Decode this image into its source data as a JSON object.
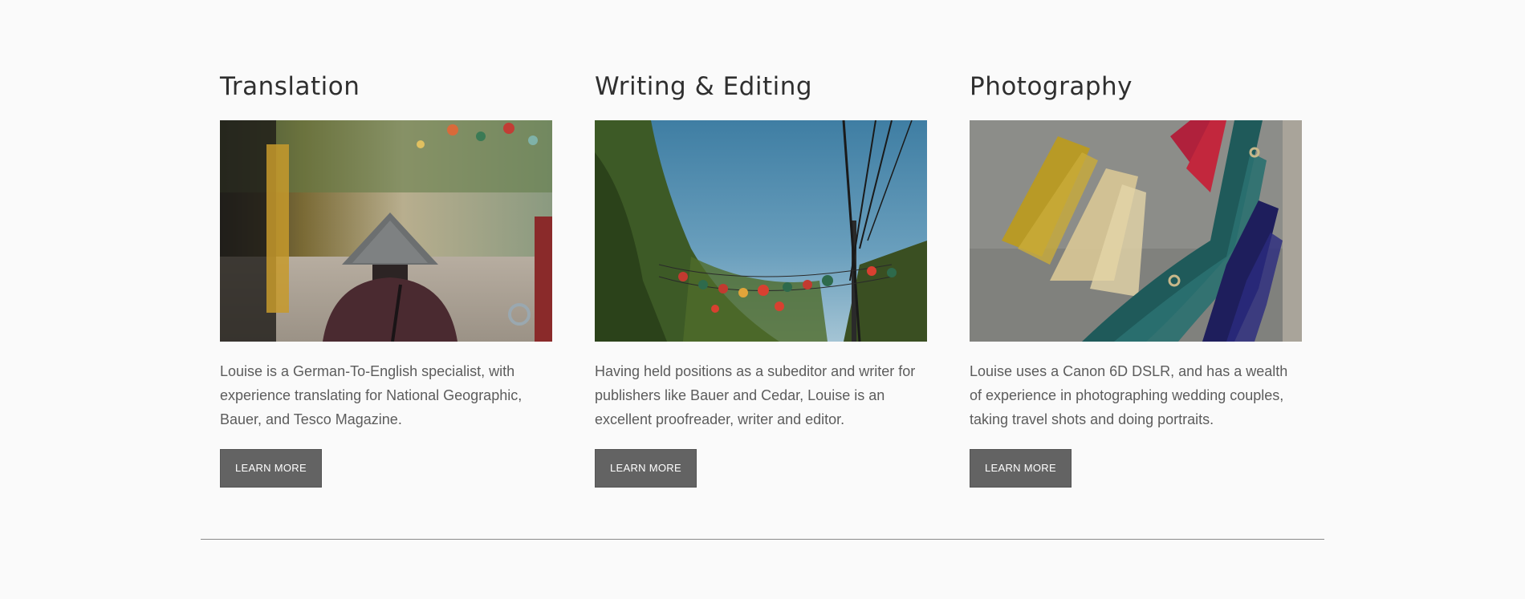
{
  "services": [
    {
      "title": "Translation",
      "image_desc_icon": "street-with-conical-hat-photo",
      "text": "Louise is a German-To-English specialist, with experience translating for National Geographic, Bauer, and Tesco Magazine.",
      "button_label": "LEARN MORE"
    },
    {
      "title": "Writing & Editing",
      "image_desc_icon": "lanterns-and-sky-photo",
      "text": "Having held positions as a subeditor and writer for publishers like Bauer and Cedar, Louise is an excellent proofreader, writer and editor.",
      "button_label": "LEARN MORE"
    },
    {
      "title": "Photography",
      "image_desc_icon": "colored-straw-bundles-photo",
      "text": "Louise uses a Canon 6D DSLR, and has a wealth of experience in photographing wedding couples, taking travel shots and doing portraits.",
      "button_label": "LEARN MORE"
    }
  ],
  "colors": {
    "background": "#fafafa",
    "heading": "#2f2f2f",
    "body_text": "#5c5c5c",
    "button_bg": "#636363",
    "button_text": "#ffffff",
    "divider": "#8a8a8a"
  }
}
